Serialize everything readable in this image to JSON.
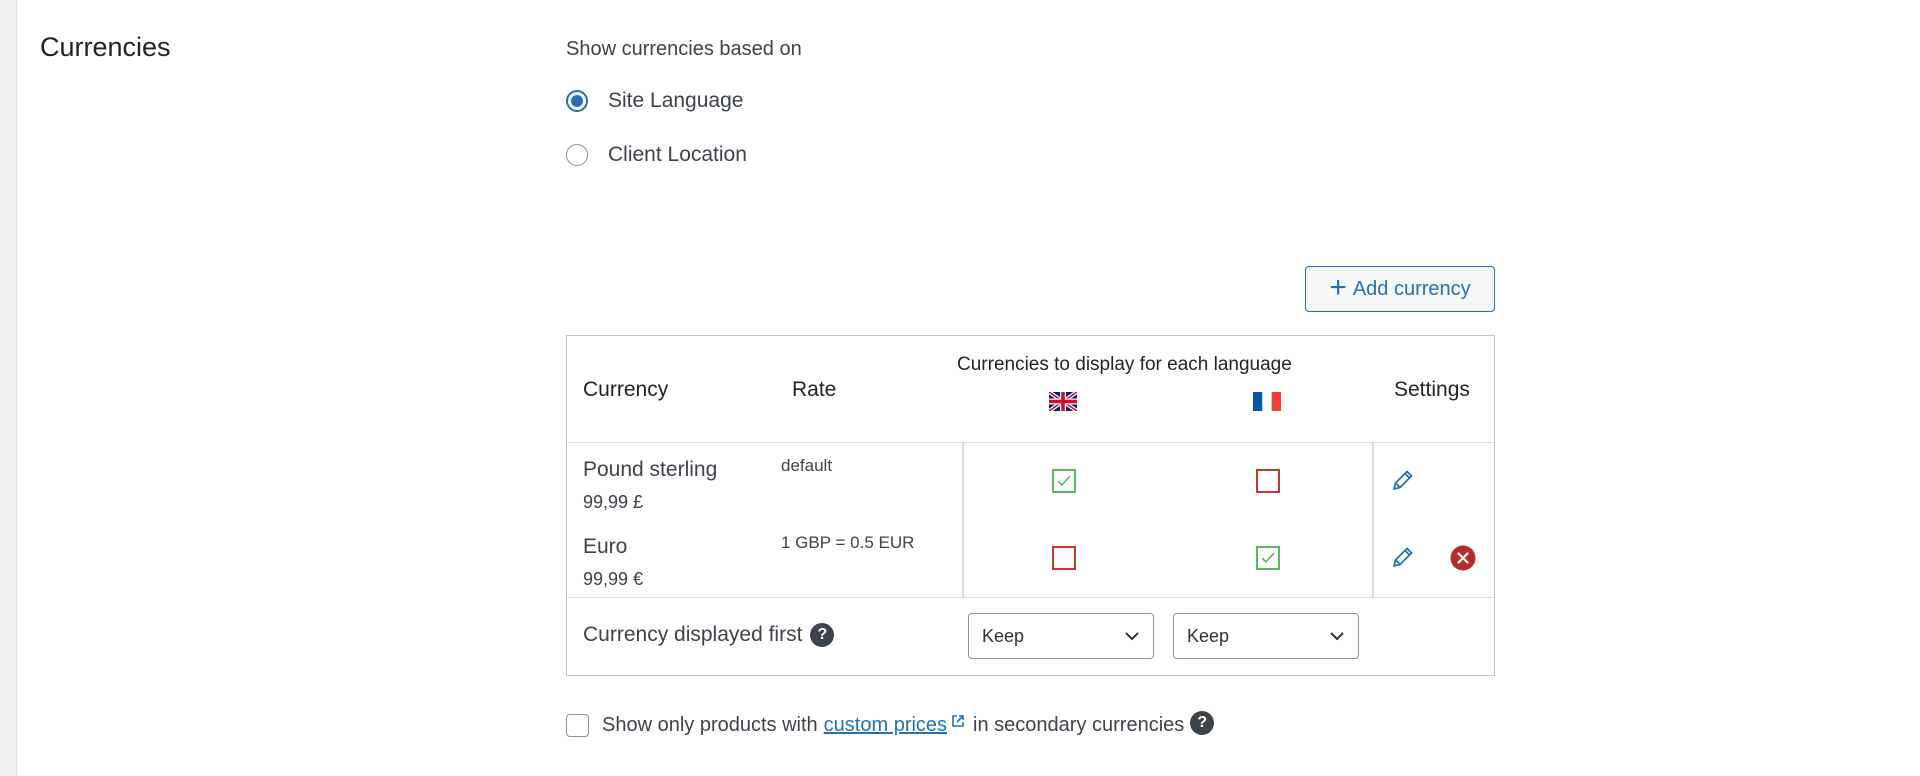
{
  "section": {
    "title": "Currencies"
  },
  "mode": {
    "label": "Show currencies based on",
    "options": [
      {
        "label": "Site Language",
        "checked": true
      },
      {
        "label": "Client Location",
        "checked": false
      }
    ]
  },
  "add_button": {
    "label": "Add currency",
    "icon": "plus-icon"
  },
  "table": {
    "headers": {
      "currency": "Currency",
      "rate": "Rate",
      "languages": "Currencies to display for each language",
      "settings": "Settings"
    },
    "languages": [
      {
        "flag": "uk-flag-icon"
      },
      {
        "flag": "france-flag-icon"
      }
    ],
    "rows": [
      {
        "name": "Pound sterling",
        "price": "99,99 £",
        "rate": "default",
        "display": [
          true,
          false
        ],
        "removable": false
      },
      {
        "name": "Euro",
        "price": "99,99 €",
        "rate": "1 GBP = 0.5 EUR",
        "display": [
          false,
          true
        ],
        "removable": true
      }
    ],
    "first_display": {
      "label": "Currency displayed first",
      "selects": [
        "Keep",
        "Keep"
      ]
    }
  },
  "custom_prices": {
    "prefix": "Show only products with",
    "link": "custom prices",
    "suffix": "in secondary currencies",
    "checked": false
  },
  "colors": {
    "accent": "#2271b1",
    "check_on": "#5cb85c",
    "check_off": "#c0392b",
    "delete": "#b32d2e"
  }
}
